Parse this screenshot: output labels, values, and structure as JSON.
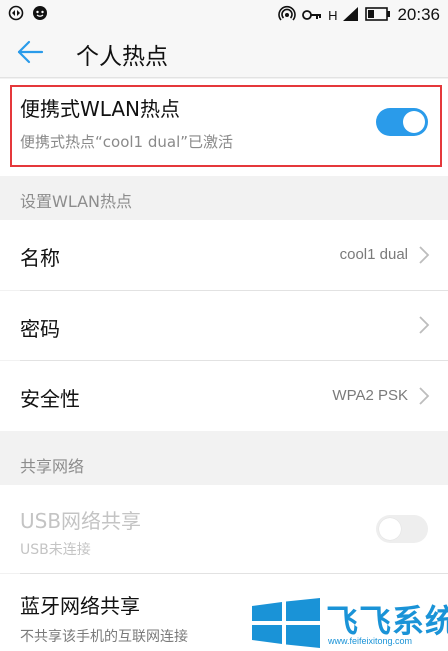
{
  "status_bar": {
    "network_label": "H",
    "time": "20:36",
    "icons": [
      "sync-icon",
      "face-icon",
      "hotspot-icon",
      "key-icon",
      "signal-icon",
      "battery-icon"
    ]
  },
  "app_bar": {
    "title": "个人热点",
    "back_icon": "arrow-left-icon"
  },
  "hotspot": {
    "title": "便携式WLAN热点",
    "subtitle": "便携式热点“cool1 dual”已激活",
    "enabled": true
  },
  "section_setup": {
    "label": "设置WLAN热点",
    "items": [
      {
        "label": "名称",
        "value": "cool1 dual"
      },
      {
        "label": "密码",
        "value": ""
      },
      {
        "label": "安全性",
        "value": "WPA2 PSK"
      }
    ]
  },
  "section_share": {
    "label": "共享网络",
    "usb": {
      "title": "USB网络共享",
      "subtitle": "USB未连接",
      "enabled": false
    },
    "bluetooth": {
      "title": "蓝牙网络共享",
      "subtitle": "不共享该手机的互联网连接"
    }
  },
  "watermark": {
    "text": "飞飞系统",
    "url": "www.feifeixitong.com"
  },
  "colors": {
    "accent": "#2a9bea",
    "highlight_border": "#e5383b",
    "background": "#f2f2f2"
  }
}
